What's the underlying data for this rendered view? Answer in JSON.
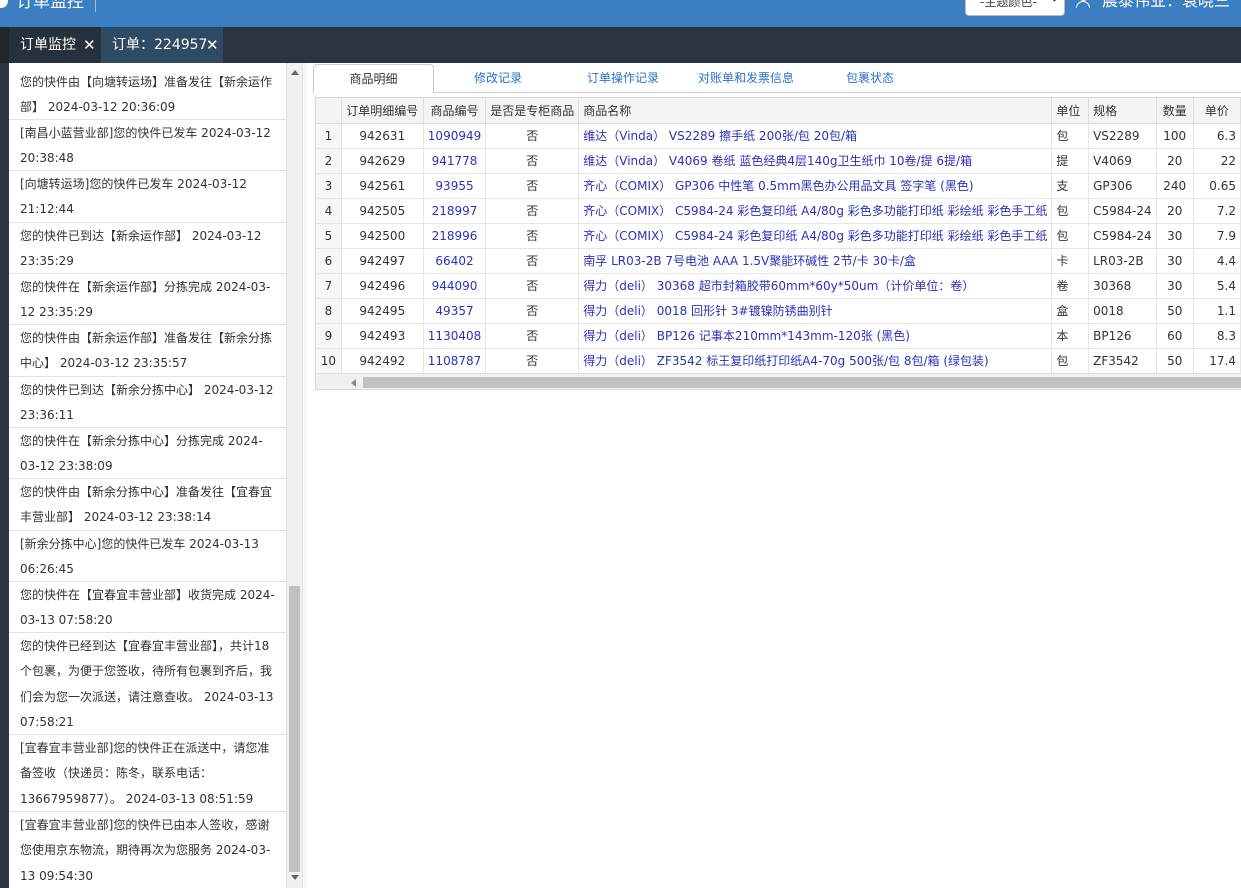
{
  "header": {
    "title": "订单监控",
    "theme_select": "-主题颜色-",
    "user": "晨泰伟业：袁晓三"
  },
  "tabs": [
    {
      "label": "订单监控"
    },
    {
      "label": "订单：224957"
    }
  ],
  "tracking_log": [
    {
      "text": "您的快件由【向塘转运场】准备发往【新余运作部】 2024-03-12 20:36:09"
    },
    {
      "text": "[南昌小蓝营业部]您的快件已发车 2024-03-12 20:38:48"
    },
    {
      "text": "[向塘转运场]您的快件已发车 2024-03-12 21:12:44"
    },
    {
      "text": "您的快件已到达【新余运作部】 2024-03-12 23:35:29"
    },
    {
      "text": "您的快件在【新余运作部】分拣完成 2024-03-12 23:35:29"
    },
    {
      "text": "您的快件由【新余运作部】准备发往【新余分拣中心】 2024-03-12 23:35:57"
    },
    {
      "text": "您的快件已到达【新余分拣中心】 2024-03-12 23:36:11"
    },
    {
      "text": "您的快件在【新余分拣中心】分拣完成 2024-03-12 23:38:09"
    },
    {
      "text": "您的快件由【新余分拣中心】准备发往【宜春宜丰营业部】 2024-03-12 23:38:14"
    },
    {
      "text": "[新余分拣中心]您的快件已发车 2024-03-13 06:26:45"
    },
    {
      "text": "您的快件在【宜春宜丰营业部】收货完成 2024-03-13 07:58:20"
    },
    {
      "text": "您的快件已经到达【宜春宜丰营业部】，共计18个包裹，为便于您签收，待所有包裹到齐后，我们会为您一次派送，请注意查收。 2024-03-13 07:58:21"
    },
    {
      "text": "[宜春宜丰营业部]您的快件正在派送中，请您准备签收（快递员：陈冬，联系电话：13667959877）。 2024-03-13 08:51:59"
    },
    {
      "text": "[宜春宜丰营业部]您的快件已由本人签收，感谢您使用京东物流，期待再次为您服务 2024-03-13 09:54:30"
    }
  ],
  "detail_tabs": [
    {
      "label": "商品明细"
    },
    {
      "label": "修改记录"
    },
    {
      "label": "订单操作记录"
    },
    {
      "label": "对账单和发票信息"
    },
    {
      "label": "包裹状态"
    }
  ],
  "table": {
    "columns": [
      "",
      "订单明细编号",
      "商品编号",
      "是否是专柜商品",
      "商品名称",
      "单位",
      "规格",
      "数量",
      "单价"
    ],
    "rows": [
      {
        "rn": "1",
        "detail_id": "942631",
        "sku": "1090949",
        "counter": "否",
        "name": "维达（Vinda） VS2289 擦手纸 200张/包 20包/箱",
        "unit": "包",
        "spec": "VS2289",
        "qty": "100",
        "price": "6.3"
      },
      {
        "rn": "2",
        "detail_id": "942629",
        "sku": "941778",
        "counter": "否",
        "name": "维达（Vinda） V4069 卷纸 蓝色经典4层140g卫生纸巾 10卷/提 6提/箱",
        "unit": "提",
        "spec": "V4069",
        "qty": "20",
        "price": "22"
      },
      {
        "rn": "3",
        "detail_id": "942561",
        "sku": "93955",
        "counter": "否",
        "name": "齐心（COMIX） GP306 中性笔 0.5mm黑色办公用品文具 签字笔 (黑色)",
        "unit": "支",
        "spec": "GP306",
        "qty": "240",
        "price": "0.65"
      },
      {
        "rn": "4",
        "detail_id": "942505",
        "sku": "218997",
        "counter": "否",
        "name": "齐心（COMIX） C5984-24 彩色复印纸 A4/80g 彩色多功能打印纸 彩绘纸 彩色手工纸",
        "unit": "包",
        "spec": "C5984-24",
        "qty": "20",
        "price": "7.2"
      },
      {
        "rn": "5",
        "detail_id": "942500",
        "sku": "218996",
        "counter": "否",
        "name": "齐心（COMIX） C5984-24 彩色复印纸 A4/80g 彩色多功能打印纸 彩绘纸 彩色手工纸",
        "unit": "包",
        "spec": "C5984-24",
        "qty": "30",
        "price": "7.9"
      },
      {
        "rn": "6",
        "detail_id": "942497",
        "sku": "66402",
        "counter": "否",
        "name": "南孚 LR03-2B 7号电池 AAA 1.5V聚能环碱性 2节/卡 30卡/盒",
        "unit": "卡",
        "spec": "LR03-2B",
        "qty": "30",
        "price": "4.4"
      },
      {
        "rn": "7",
        "detail_id": "942496",
        "sku": "944090",
        "counter": "否",
        "name": "得力（deli） 30368 超市封箱胶带60mm*60y*50um（计价单位：卷）",
        "unit": "卷",
        "spec": "30368",
        "qty": "30",
        "price": "5.4"
      },
      {
        "rn": "8",
        "detail_id": "942495",
        "sku": "49357",
        "counter": "否",
        "name": "得力（deli） 0018 回形针 3#镀镍防锈曲别针",
        "unit": "盒",
        "spec": "0018",
        "qty": "50",
        "price": "1.1"
      },
      {
        "rn": "9",
        "detail_id": "942493",
        "sku": "1130408",
        "counter": "否",
        "name": "得力（deli） BP126 记事本210mm*143mm-120张 (黑色)",
        "unit": "本",
        "spec": "BP126",
        "qty": "60",
        "price": "8.3"
      },
      {
        "rn": "10",
        "detail_id": "942492",
        "sku": "1108787",
        "counter": "否",
        "name": "得力（deli） ZF3542 标王复印纸打印纸A4-70g 500张/包 8包/箱 (绿包装)",
        "unit": "包",
        "spec": "ZF3542",
        "qty": "50",
        "price": "17.4"
      }
    ]
  }
}
